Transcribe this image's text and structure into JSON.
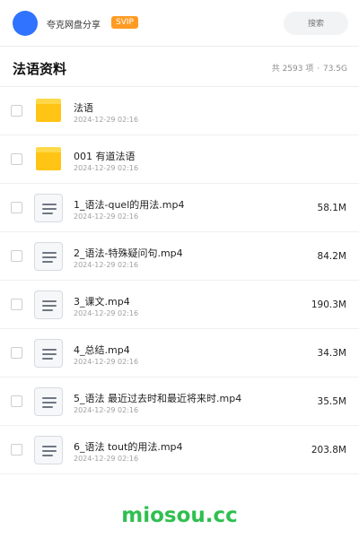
{
  "header": {
    "share_name": "夸克网盘分享",
    "badge": "SVIP",
    "search_placeholder": "搜索"
  },
  "folder": {
    "title": "法语资料",
    "count_text": "共 2593 项",
    "separator": "·",
    "total_size": "73.5G"
  },
  "items": [
    {
      "type": "folder",
      "name": "法语",
      "date": "2024-12-29 02:16",
      "size": ""
    },
    {
      "type": "folder",
      "name": "001 有道法语",
      "date": "2024-12-29 02:16",
      "size": ""
    },
    {
      "type": "file",
      "name": "1_语法-quel的用法.mp4",
      "date": "2024-12-29 02:16",
      "size": "58.1M"
    },
    {
      "type": "file",
      "name": "2_语法-特殊疑问句.mp4",
      "date": "2024-12-29 02:16",
      "size": "84.2M"
    },
    {
      "type": "file",
      "name": "3_课文.mp4",
      "date": "2024-12-29 02:16",
      "size": "190.3M"
    },
    {
      "type": "file",
      "name": "4_总结.mp4",
      "date": "2024-12-29 02:16",
      "size": "34.3M"
    },
    {
      "type": "file",
      "name": "5_语法 最近过去时和最近将来时.mp4",
      "date": "2024-12-29 02:16",
      "size": "35.5M"
    },
    {
      "type": "file",
      "name": "6_语法 tout的用法.mp4",
      "date": "2024-12-29 02:16",
      "size": "203.8M"
    }
  ],
  "watermark": "miosou.cc",
  "colors": {
    "accent_blue": "#2f73ff",
    "svip_orange": "#ff9b22",
    "folder_yellow": "#ffc414",
    "watermark_green": "#2fbf4f"
  }
}
